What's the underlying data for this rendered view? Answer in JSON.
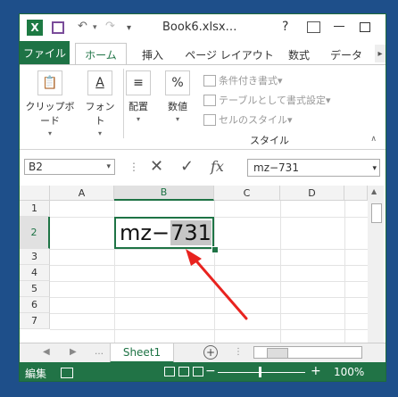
{
  "titlebar": {
    "app_icon": "X",
    "doc_title": "Book6.xlsx…",
    "help": "?"
  },
  "tabs": {
    "file": "ファイル",
    "home": "ホーム",
    "insert": "挿入",
    "page_layout": "ページ レイアウト",
    "formulas": "数式",
    "data": "データ"
  },
  "ribbon": {
    "clipboard": "クリップボード",
    "font": "フォント",
    "alignment": "配置",
    "number": "数値",
    "number_icon": "%",
    "cond_format": "条件付き書式",
    "table_format": "テーブルとして書式設定",
    "cell_style": "セルのスタイル",
    "styles_group": "スタイル"
  },
  "formula_bar": {
    "name_box": "B2",
    "fx": "fx",
    "content": "mz−731"
  },
  "grid": {
    "columns": [
      "A",
      "B",
      "C",
      "D"
    ],
    "selected_column": "B",
    "rows": [
      "1",
      "2",
      "3",
      "4",
      "5",
      "6",
      "7"
    ],
    "selected_row": "2",
    "cell_b2_prefix": "mz−",
    "cell_b2_selected": "731"
  },
  "sheets": {
    "active": "Sheet1"
  },
  "status": {
    "mode": "編集",
    "zoom": "100%"
  },
  "colors": {
    "excel_green": "#217346",
    "annotation_arrow": "#e8231f"
  }
}
